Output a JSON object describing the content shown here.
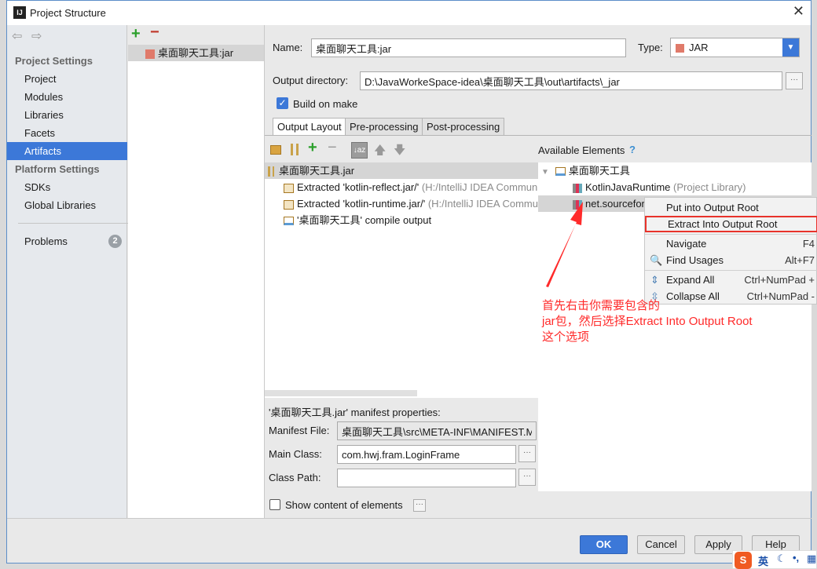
{
  "window": {
    "title": "Project Structure"
  },
  "sidebar": {
    "project_settings_header": "Project Settings",
    "items": [
      {
        "label": "Project"
      },
      {
        "label": "Modules"
      },
      {
        "label": "Libraries"
      },
      {
        "label": "Facets"
      },
      {
        "label": "Artifacts",
        "selected": true
      }
    ],
    "platform_settings_header": "Platform Settings",
    "platform_items": [
      {
        "label": "SDKs"
      },
      {
        "label": "Global Libraries"
      }
    ],
    "problems": {
      "label": "Problems",
      "count": "2"
    }
  },
  "artifacts_list": {
    "items": [
      {
        "label": "桌面聊天工具:jar"
      }
    ]
  },
  "form": {
    "name_label": "Name:",
    "name_value": "桌面聊天工具:jar",
    "type_label": "Type:",
    "type_value": "JAR",
    "output_dir_label": "Output directory:",
    "output_dir_value": "D:\\JavaWorkeSpace-idea\\桌面聊天工具\\out\\artifacts\\_jar",
    "build_on_make_label": "Build on make",
    "build_on_make_checked": true
  },
  "tabs": [
    {
      "label": "Output Layout",
      "active": true
    },
    {
      "label": "Pre-processing"
    },
    {
      "label": "Post-processing"
    }
  ],
  "output_layout": {
    "root": "桌面聊天工具.jar",
    "items": [
      {
        "label": "Extracted 'kotlin-reflect.jar/'",
        "detail": "(H:/IntelliJ IDEA Commun"
      },
      {
        "label": "Extracted 'kotlin-runtime.jar/'",
        "detail": "(H:/IntelliJ IDEA Commu"
      },
      {
        "label": "'桌面聊天工具' compile output",
        "detail": ""
      }
    ]
  },
  "available": {
    "header": "Available Elements",
    "help": "?",
    "root": "桌面聊天工具",
    "items": [
      {
        "label": "KotlinJavaRuntime",
        "detail": "(Project Library)"
      },
      {
        "label": "net.sourcefor",
        "detail": ""
      }
    ]
  },
  "context_menu": {
    "items": [
      {
        "label": "Put into Output Root",
        "shortcut": ""
      },
      {
        "label": "Extract Into Output Root",
        "shortcut": "",
        "highlighted": true
      },
      {
        "label": "Navigate",
        "shortcut": "F4"
      },
      {
        "label": "Find Usages",
        "shortcut": "Alt+F7"
      },
      {
        "label": "Expand All",
        "shortcut": "Ctrl+NumPad +"
      },
      {
        "label": "Collapse All",
        "shortcut": "Ctrl+NumPad -"
      }
    ]
  },
  "annotation": {
    "line1": "首先右击你需要包含的",
    "line2": "jar包，然后选择Extract Into Output Root",
    "line3": "这个选项",
    "color": "#ff2a2a"
  },
  "manifest": {
    "title": "'桌面聊天工具.jar' manifest properties:",
    "file_label": "Manifest File:",
    "file_value": "桌面聊天工具\\src\\META-INF\\MANIFEST.MF",
    "main_class_label": "Main Class:",
    "main_class_value": "com.hwj.fram.LoginFrame",
    "class_path_label": "Class Path:",
    "class_path_value": ""
  },
  "show_content_label": "Show content of elements",
  "buttons": {
    "ok": "OK",
    "cancel": "Cancel",
    "apply": "Apply",
    "help": "Help"
  },
  "ime": {
    "label": "英"
  },
  "colors": {
    "accent": "#3c78d8",
    "annotation": "#ff2a2a"
  }
}
